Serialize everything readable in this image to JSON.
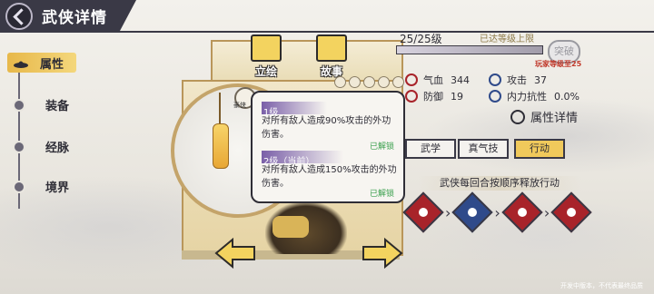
{
  "header": {
    "title": "武侠详情"
  },
  "sidebar": {
    "items": [
      {
        "label": "属性"
      },
      {
        "label": "装备"
      },
      {
        "label": "经脉"
      },
      {
        "label": "境界"
      }
    ]
  },
  "top_tabs": [
    {
      "label": "立绘"
    },
    {
      "label": "故事"
    }
  ],
  "badge": {
    "label": "豪侠"
  },
  "level": {
    "text": "25/25级",
    "max_text": "已达等级上限",
    "progress": 1.0
  },
  "breakthrough": {
    "label": "突破",
    "requirement": "玩家等级至25"
  },
  "stats": {
    "hp_label": "气血",
    "hp_value": "344",
    "atk_label": "攻击",
    "atk_value": "37",
    "def_label": "防御",
    "def_value": "19",
    "res_label": "内力抗性",
    "res_value": "0.0%"
  },
  "attr_detail_label": "属性详情",
  "skill_tabs": [
    {
      "label": "武学"
    },
    {
      "label": "真气技"
    },
    {
      "label": "行动"
    }
  ],
  "action_order": {
    "title": "武侠每回合按顺序释放行动"
  },
  "popup": {
    "lv1": {
      "head": "1级",
      "desc": "对所有敌人造成90%攻击的外功伤害。",
      "status": "已解锁"
    },
    "lv2": {
      "head": "2级（当前）",
      "desc": "对所有敌人造成150%攻击的外功伤害。",
      "status": "已解锁"
    }
  },
  "footer_note": "开发中版本，不代表最终品质",
  "colors": {
    "accent": "#f0c95b",
    "header": "#3a3946",
    "unlock": "#3aa04d",
    "warning": "#c0392b",
    "attack_icon": "#a8232a",
    "defense_icon": "#2f4a8a"
  }
}
